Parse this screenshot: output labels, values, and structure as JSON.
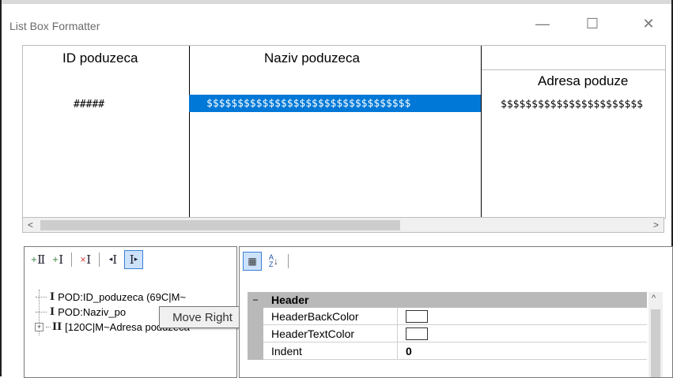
{
  "window": {
    "title": "List Box Formatter",
    "minimize_glyph": "—",
    "maximize_glyph": "☐",
    "close_glyph": "✕"
  },
  "preview": {
    "columns": [
      {
        "header": "ID poduzeca",
        "value": "#####",
        "selected": false
      },
      {
        "header": "Naziv poduzeca",
        "value": "$$$$$$$$$$$$$$$$$$$$$$$$$$$$$$$$$",
        "selected": true
      },
      {
        "group_header": "",
        "header": "Adresa poduze",
        "value": "$$$$$$$$$$$$$$$$$$$$$$$"
      }
    ],
    "scroll_left": "<",
    "scroll_right": ">"
  },
  "tree": {
    "toolbar": [
      "insert-icon",
      "append-icon",
      "delete-icon",
      "move-left-icon",
      "move-right-icon"
    ],
    "items": [
      {
        "label": "POD:ID_poduzeca (69C|M~"
      },
      {
        "label": "POD:Naziv_po"
      },
      {
        "label": "[120C|M~Adresa poduzeca"
      }
    ],
    "expander": "+"
  },
  "tooltip": {
    "text": "Move Right"
  },
  "properties": {
    "category": "Header",
    "collapse_glyph": "−",
    "rows": [
      {
        "name": "HeaderBackColor",
        "value": "",
        "swatch": "#ffffff"
      },
      {
        "name": "HeaderTextColor",
        "value": "",
        "swatch": "#ffffff"
      },
      {
        "name": "Indent",
        "value": "0"
      }
    ],
    "scroll_up": "^"
  },
  "colors": {
    "selection": "#0078d7",
    "selection_text": "#ffffff",
    "category_bg": "#b9b9b9",
    "active_button": "#cce2fb"
  }
}
